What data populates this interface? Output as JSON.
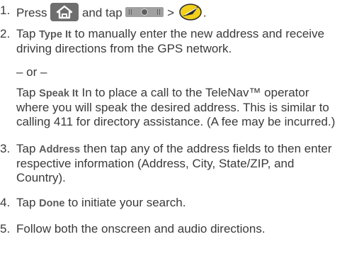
{
  "step1": {
    "num": "1.",
    "press": "Press",
    "and_tap": "and tap",
    "gt": ">",
    "period": ".",
    "icons": [
      "home-icon",
      "menu-bar-icon",
      "telenav-icon"
    ]
  },
  "step2": {
    "num": "2.",
    "tap": "Tap",
    "type_it": "Type It",
    "rest": "to manually enter the new address and receive driving directions from the GPS network.",
    "or": "– or –",
    "tap2": "Tap",
    "speak_it": "Speak It",
    "rest2": "In to place a call to the TeleNav™ operator where you will speak the desired address. This is similar to calling 411 for directory assistance. (A fee may be incurred.)"
  },
  "step3": {
    "num": "3.",
    "tap": "Tap",
    "address": "Address",
    "rest": "then tap any of the address fields to then enter respective information (Address, City, State/ZIP, and Country)."
  },
  "step4": {
    "num": "4.",
    "tap": "Tap",
    "done": "Done",
    "rest": "to initiate your search."
  },
  "step5": {
    "num": "5.",
    "text": "Follow both the onscreen and audio directions."
  },
  "colors": {
    "text": "#3a3a3a",
    "bold": "#5a5a5a",
    "home_icon_bg": "#6e6e6e",
    "bar_icon_bg": "#a0a0a0",
    "telenav_yellow": "#f2cf1a"
  }
}
